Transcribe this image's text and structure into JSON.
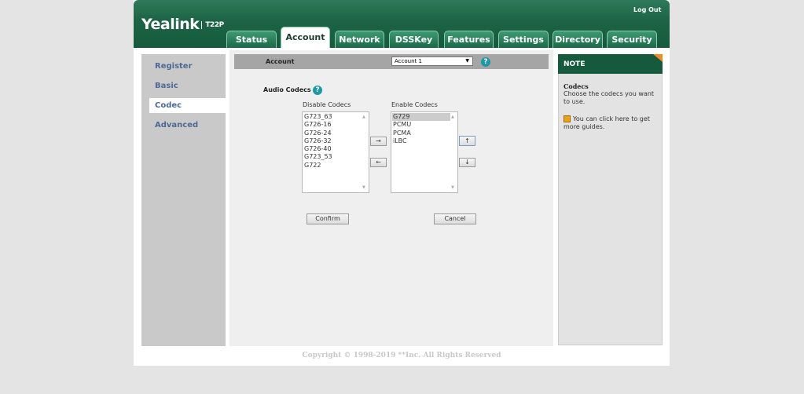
{
  "header": {
    "brand": "Yealink",
    "model": "T22P",
    "logout": "Log Out"
  },
  "tabs": [
    {
      "label": "Status"
    },
    {
      "label": "Account"
    },
    {
      "label": "Network"
    },
    {
      "label": "DSSKey"
    },
    {
      "label": "Features"
    },
    {
      "label": "Settings"
    },
    {
      "label": "Directory"
    },
    {
      "label": "Security"
    }
  ],
  "sidebar": {
    "items": [
      {
        "label": "Register"
      },
      {
        "label": "Basic"
      },
      {
        "label": "Codec"
      },
      {
        "label": "Advanced"
      }
    ]
  },
  "account": {
    "label": "Account",
    "selected": "Account 1"
  },
  "codecs": {
    "title": "Audio Codecs",
    "disable_label": "Disable Codecs",
    "enable_label": "Enable Codecs",
    "disabled": [
      "G723_63",
      "G726-16",
      "G726-24",
      "G726-32",
      "G726-40",
      "G723_53",
      "G722"
    ],
    "enabled": [
      "G729",
      "PCMU",
      "PCMA",
      "iLBC"
    ],
    "move_right": "→",
    "move_left": "←",
    "move_up": "↑",
    "move_down": "↓",
    "confirm": "Confirm",
    "cancel": "Cancel"
  },
  "note": {
    "title": "NOTE",
    "heading": "Codecs",
    "text": "Choose the codecs you want to use.",
    "guide": "You can click here to get more guides."
  },
  "footer": {
    "copyright": "Copyright © 1998-2019 **Inc. All Rights Reserved"
  },
  "colors": {
    "brand_green": "#155a3c",
    "accent_orange": "#f08a24",
    "help_teal": "#1a9aa8"
  }
}
